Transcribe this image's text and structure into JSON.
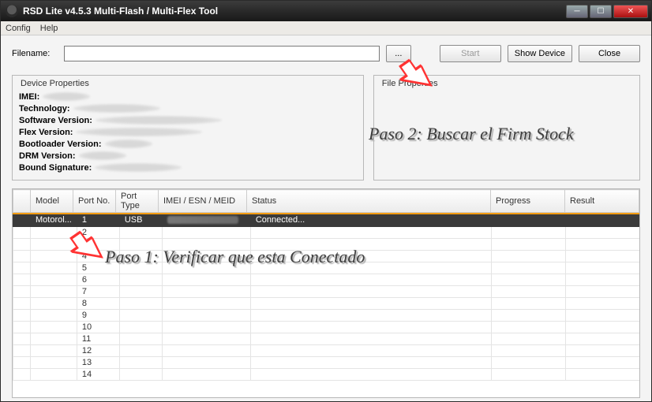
{
  "window": {
    "title": "RSD Lite v4.5.3 Multi-Flash / Multi-Flex Tool"
  },
  "menu": {
    "config": "Config",
    "help": "Help"
  },
  "toolbar": {
    "filename_label": "Filename:",
    "filename_value": "",
    "browse_label": "...",
    "start_label": "Start",
    "show_device_label": "Show Device",
    "close_label": "Close"
  },
  "device_properties": {
    "legend": "Device Properties",
    "imei": "IMEI:",
    "technology": "Technology:",
    "software_version": "Software Version:",
    "flex_version": "Flex Version:",
    "bootloader_version": "Bootloader Version:",
    "drm_version": "DRM Version:",
    "bound_signature": "Bound Signature:"
  },
  "file_properties": {
    "legend": "File Properties"
  },
  "table": {
    "headers": {
      "model": "Model",
      "port_no": "Port No.",
      "port_type": "Port Type",
      "imei": "IMEI / ESN / MEID",
      "status": "Status",
      "progress": "Progress",
      "result": "Result"
    },
    "row1": {
      "model": "Motorol...",
      "port_no": "1",
      "port_type": "USB",
      "status": "Connected..."
    },
    "port_numbers": [
      "2",
      "3",
      "4",
      "5",
      "6",
      "7",
      "8",
      "9",
      "10",
      "11",
      "12",
      "13",
      "14"
    ]
  },
  "annotations": {
    "paso2": "Paso 2: Buscar el Firm Stock",
    "paso1": "Paso 1: Verificar que esta Conectado"
  }
}
